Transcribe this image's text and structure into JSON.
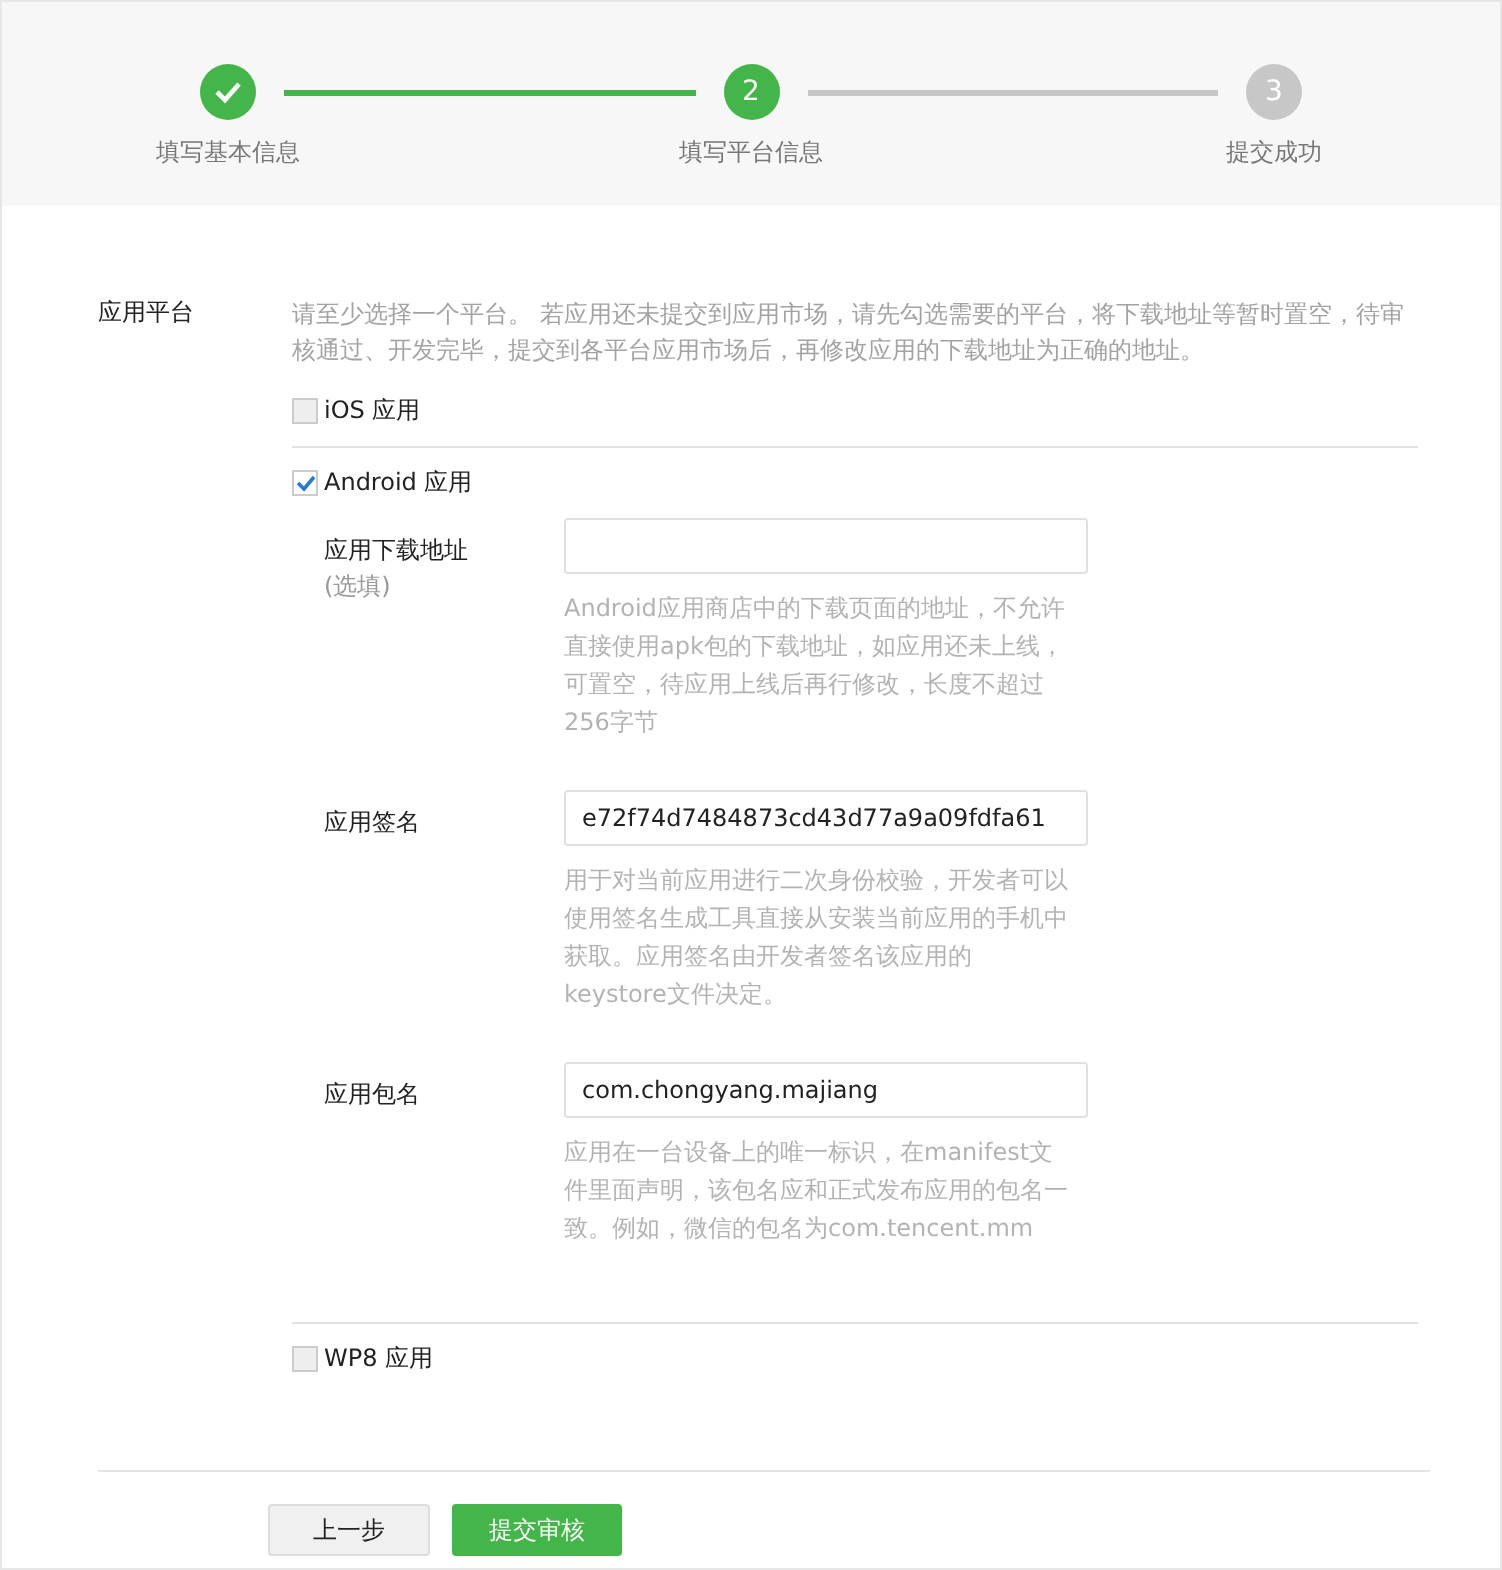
{
  "steps": [
    {
      "label": "填写基本信息",
      "kind": "done"
    },
    {
      "number": "2",
      "label": "填写平台信息",
      "kind": "current"
    },
    {
      "number": "3",
      "label": "提交成功",
      "kind": "pending"
    }
  ],
  "platform": {
    "label": "应用平台",
    "description": "请至少选择一个平台。 若应用还未提交到应用市场，请先勾选需要的平台，将下载地址等暂时置空，待审核通过、开发完毕，提交到各平台应用市场后，再修改应用的下载地址为正确的地址。",
    "options": [
      {
        "label": "iOS 应用",
        "checked": false
      },
      {
        "label": "Android 应用",
        "checked": true,
        "fields": [
          {
            "label": "应用下载地址",
            "note": "(选填)",
            "help": "Android应用商店中的下载页面的地址，不允许直接使用apk包的下载地址，如应用还未上线，可置空，待应用上线后再行修改，长度不超过256字节"
          },
          {
            "label": "应用签名",
            "value": "e72f74d7484873cd43d77a9a09fdfa61",
            "help": "用于对当前应用进行二次身份校验，开发者可以使用签名生成工具直接从安装当前应用的手机中获取。应用签名由开发者签名该应用的keystore文件决定。"
          },
          {
            "label": "应用包名",
            "value": "com.chongyang.majiang",
            "help": "应用在一台设备上的唯一标识，在manifest文件里面声明，该包名应和正式发布应用的包名一致。例如，微信的包名为com.tencent.mm"
          }
        ]
      },
      {
        "label": "WP8 应用",
        "checked": false
      }
    ]
  },
  "buttons": [
    {
      "label": "上一步",
      "kind": "secondary"
    },
    {
      "label": "提交审核",
      "kind": "primary"
    }
  ]
}
